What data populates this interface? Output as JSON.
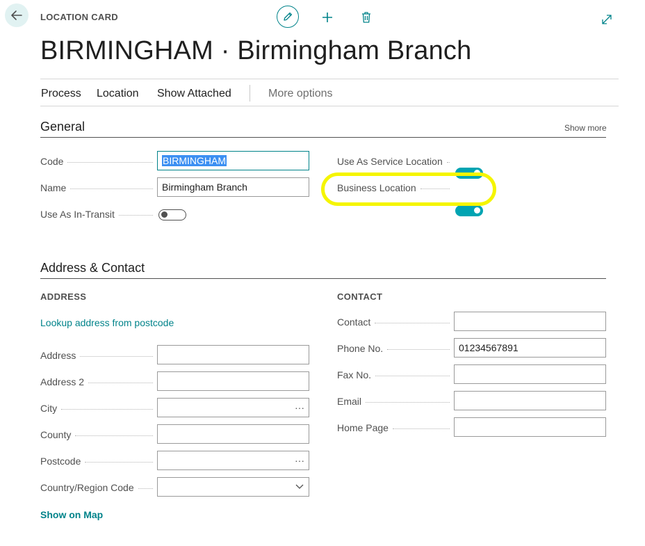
{
  "header": {
    "caption": "LOCATION CARD",
    "title": "BIRMINGHAM · Birmingham Branch",
    "icons": [
      "back-arrow-icon",
      "pencil-icon",
      "plus-icon",
      "trash-icon",
      "expand-icon"
    ]
  },
  "actions": {
    "process": "Process",
    "location": "Location",
    "show_attached": "Show Attached",
    "more_options": "More options"
  },
  "general": {
    "title": "General",
    "show_more": "Show more",
    "code": {
      "label": "Code",
      "value": "BIRMINGHAM",
      "selected": true
    },
    "name": {
      "label": "Name",
      "value": "Birmingham Branch"
    },
    "use_as_in_transit": {
      "label": "Use As In-Transit",
      "on": false
    },
    "use_as_service_location": {
      "label": "Use As Service Location",
      "on": true
    },
    "business_location": {
      "label": "Business Location",
      "on": true
    }
  },
  "address_contact": {
    "title": "Address & Contact",
    "address": {
      "heading": "ADDRESS",
      "lookup_link": "Lookup address from postcode",
      "address": {
        "label": "Address",
        "value": ""
      },
      "address_2": {
        "label": "Address 2",
        "value": ""
      },
      "city": {
        "label": "City",
        "value": "",
        "trail": "···"
      },
      "county": {
        "label": "County",
        "value": ""
      },
      "postcode": {
        "label": "Postcode",
        "value": "",
        "trail": "···"
      },
      "country_region_code": {
        "label": "Country/Region Code",
        "value": ""
      },
      "show_on_map": "Show on Map"
    },
    "contact": {
      "heading": "CONTACT",
      "contact": {
        "label": "Contact",
        "value": ""
      },
      "phone_no": {
        "label": "Phone No.",
        "value": "01234567891"
      },
      "fax_no": {
        "label": "Fax No.",
        "value": ""
      },
      "email": {
        "label": "Email",
        "value": ""
      },
      "home_page": {
        "label": "Home Page",
        "value": ""
      }
    }
  },
  "colors": {
    "accent": "#00838a",
    "toggle_on": "#00a4b2",
    "highlight": "#f5f500",
    "selection": "#3c8ff2"
  }
}
